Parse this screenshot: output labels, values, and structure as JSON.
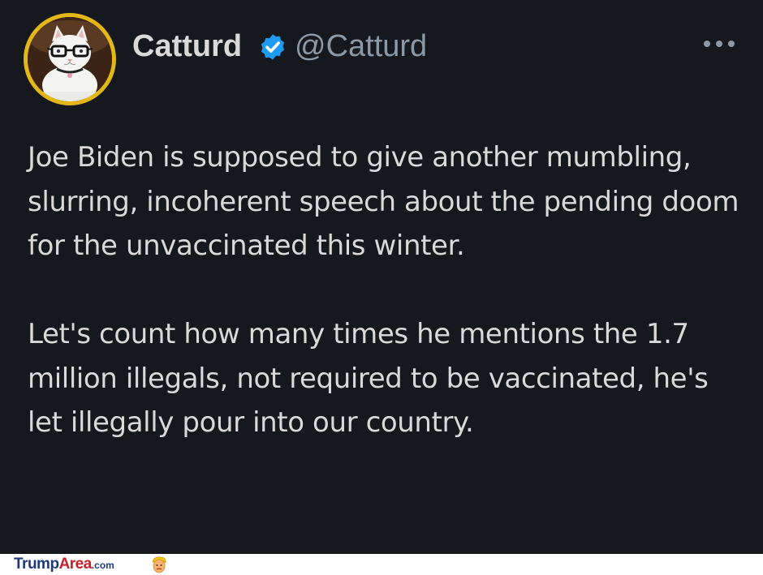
{
  "tweet": {
    "display_name": "Catturd",
    "handle": "@Catturd",
    "verified_icon": "verified-badge-icon",
    "more_icon": "more-horizontal-icon",
    "avatar": "cat-with-glasses-avatar",
    "paragraphs": [
      "Joe Biden is supposed to give another mumbling, slurring, incoherent speech about the pending doom for the unvaccinated this winter.",
      "Let's count how many times he mentions the 1.7 million illegals, not required to be vaccinated, he's let illegally pour into our country."
    ]
  },
  "watermark": {
    "brand_part1": "Trump",
    "brand_part2": "Area",
    "brand_suffix": ".com"
  },
  "colors": {
    "background": "#15181c",
    "text": "#d9d9d9",
    "secondary_text": "#8b98a5",
    "verified_blue": "#1d9bf0",
    "avatar_ring": "#e3b816"
  }
}
